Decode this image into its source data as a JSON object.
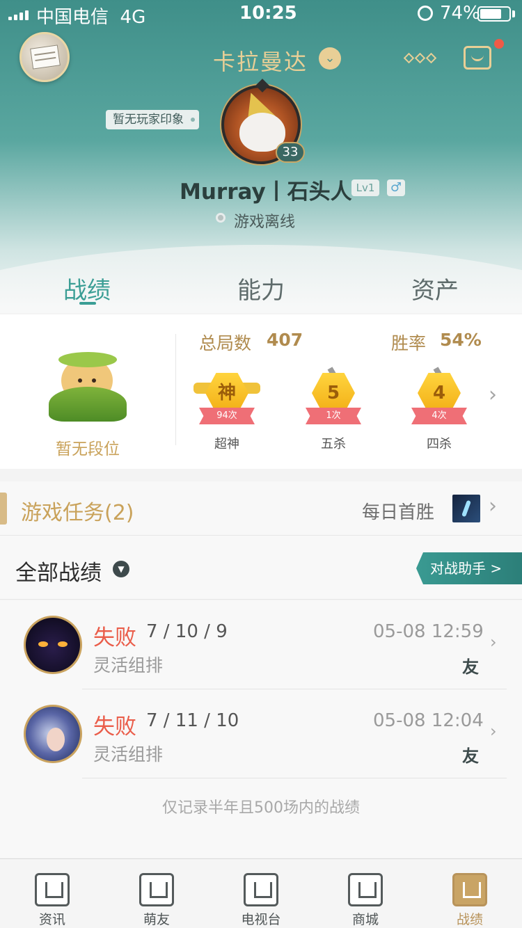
{
  "status_bar": {
    "carrier": "中国电信",
    "network": "4G",
    "time": "10:25",
    "battery_percent": "74%",
    "battery_level": 0.74
  },
  "header": {
    "server_name": "卡拉曼达",
    "impression_tag": "暂无玩家印象",
    "player_level": "33",
    "player_name": "Murray丨石头人",
    "account_level": "Lv1",
    "gender_symbol": "♂",
    "online_status": "游戏离线",
    "colors": {
      "teal": "#3f8f89",
      "gold": "#e9cf96",
      "notification": "#ef5a47"
    }
  },
  "tabs": [
    {
      "label": "战绩",
      "active": true
    },
    {
      "label": "能力",
      "active": false
    },
    {
      "label": "资产",
      "active": false
    }
  ],
  "stats": {
    "rank_text": "暂无段位",
    "total_games_label": "总局数",
    "total_games_value": "407",
    "win_rate_label": "胜率",
    "win_rate_value": "54%",
    "medals": [
      {
        "glyph": "神",
        "count": "94次",
        "label": "超神"
      },
      {
        "glyph": "5",
        "count": "1次",
        "label": "五杀"
      },
      {
        "glyph": "4",
        "count": "4次",
        "label": "四杀"
      }
    ]
  },
  "missions": {
    "title": "游戏任务(2)",
    "daily_label": "每日首胜"
  },
  "matches": {
    "title": "全部战绩",
    "assistant_label": "对战助手 >",
    "items": [
      {
        "result": "失败",
        "kda": "7 / 10 / 9",
        "time": "05-08 12:59",
        "mode": "灵活组排",
        "tag": "友"
      },
      {
        "result": "失败",
        "kda": "7 / 11 / 10",
        "time": "05-08 12:04",
        "mode": "灵活组排",
        "tag": "友"
      }
    ],
    "note": "仅记录半年且500场内的战绩"
  },
  "bottom_nav": [
    {
      "label": "资讯",
      "icon": "news-icon",
      "active": false
    },
    {
      "label": "萌友",
      "icon": "friends-icon",
      "active": false
    },
    {
      "label": "电视台",
      "icon": "tv-icon",
      "active": false
    },
    {
      "label": "商城",
      "icon": "shop-icon",
      "active": false
    },
    {
      "label": "战绩",
      "icon": "record-icon",
      "active": true
    }
  ]
}
